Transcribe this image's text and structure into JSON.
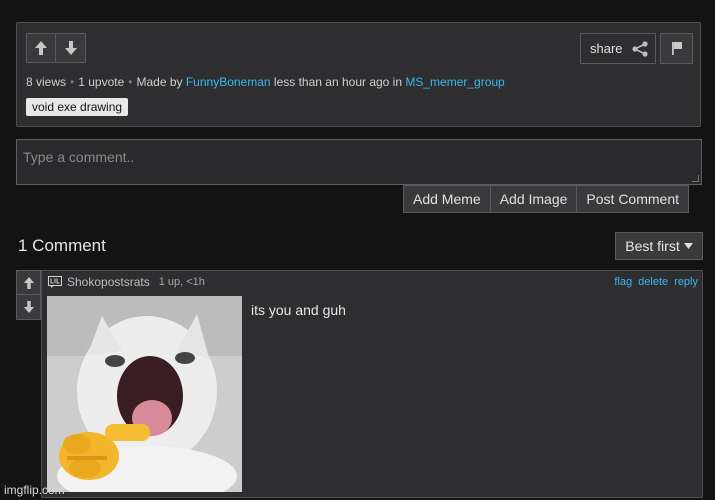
{
  "post": {
    "views": "8 views",
    "upvotes": "1 upvote",
    "made_by_prefix": "Made by",
    "author": "FunnyBoneman",
    "time_text": "less than an hour ago in",
    "group": "MS_memer_group",
    "tag": "void exe drawing",
    "share_label": "share"
  },
  "composer": {
    "placeholder": "Type a comment..",
    "add_meme": "Add Meme",
    "add_image": "Add Image",
    "post_comment": "Post Comment"
  },
  "comments_header": {
    "count_text": "1 Comment",
    "sort_label": "Best first"
  },
  "comment": {
    "username": "Shokopostsrats",
    "meta": "1 up, <1h",
    "flag": "flag",
    "delete": "delete",
    "reply": "reply",
    "text": "its you and guh"
  },
  "watermark": "imgflip.com"
}
